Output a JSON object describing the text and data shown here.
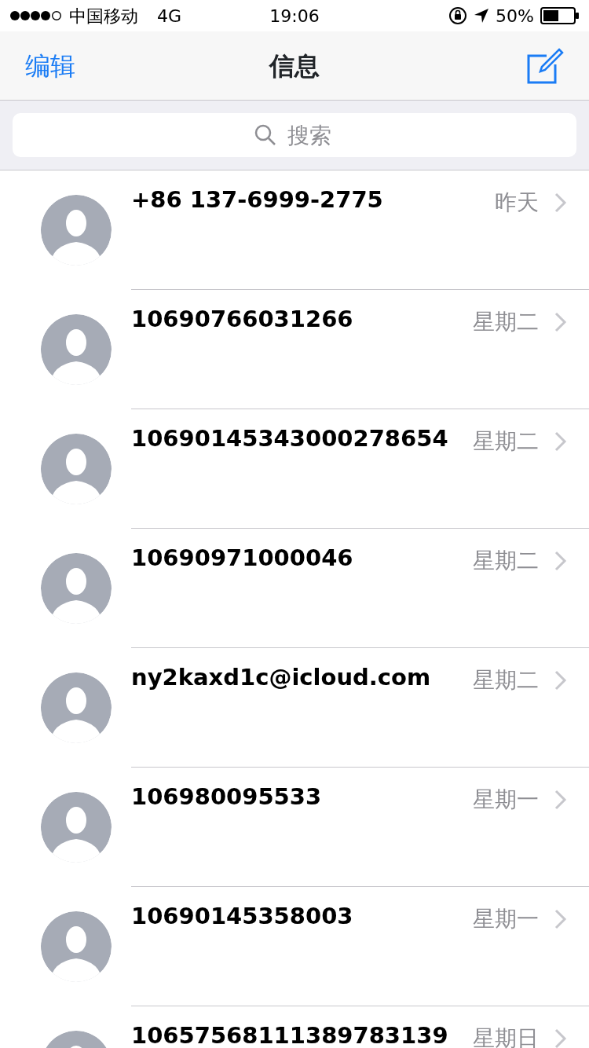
{
  "status_bar": {
    "carrier": "中国移动",
    "network": "4G",
    "time": "19:06",
    "battery": "50%"
  },
  "nav": {
    "edit": "编辑",
    "title": "信息"
  },
  "search": {
    "placeholder": "搜索"
  },
  "conversations": [
    {
      "name": "+86 137-6999-2775",
      "date": "昨天"
    },
    {
      "name": "10690766031266",
      "date": "星期二"
    },
    {
      "name": "10690145343000278654",
      "date": "星期二"
    },
    {
      "name": "10690971000046",
      "date": "星期二"
    },
    {
      "name": "ny2kaxd1c@icloud.com",
      "date": "星期二"
    },
    {
      "name": "106980095533",
      "date": "星期一"
    },
    {
      "name": "10690145358003",
      "date": "星期一"
    },
    {
      "name": "10657568111389783139",
      "date": "星期日"
    }
  ]
}
